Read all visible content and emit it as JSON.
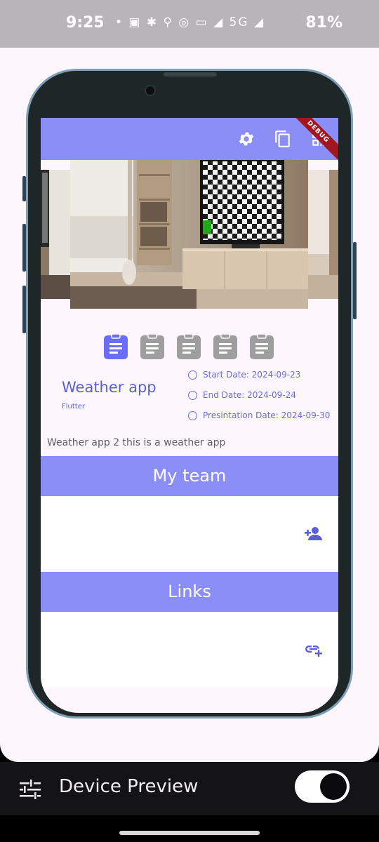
{
  "status_bar": {
    "time": "9:25",
    "icons_text": "•  ▣  ✱  ⚲  ◎  ▭  ◢  5G ◢",
    "battery": "81%"
  },
  "device": {
    "debug_label": "DEBUG"
  },
  "app_bar": {
    "actions": [
      "gear-icon",
      "copy-icon",
      "qr-code-icon"
    ]
  },
  "steps": {
    "count": 5,
    "active_index": 0,
    "active_color": "#6a6ef5",
    "inactive_color": "#9e9e9e"
  },
  "project": {
    "title": "Weather app",
    "subtitle": "Flutter",
    "start_date": "Start Date: 2024-09-23",
    "end_date": "End Date: 2024-09-24",
    "presentation_date": "Presintation Date: 2024-09-30",
    "description": "Weather app 2 this is a weather app"
  },
  "team": {
    "header": "My team",
    "action_icon": "person-add-icon"
  },
  "links": {
    "header": "Links",
    "action_icon": "add-link-icon"
  },
  "toolbar": {
    "title": "Device Preview",
    "toggle_on": true
  },
  "colors": {
    "accent": "#8b8ef7",
    "accent_dark": "#5a5fd8",
    "toolbar_bg": "#141316"
  }
}
